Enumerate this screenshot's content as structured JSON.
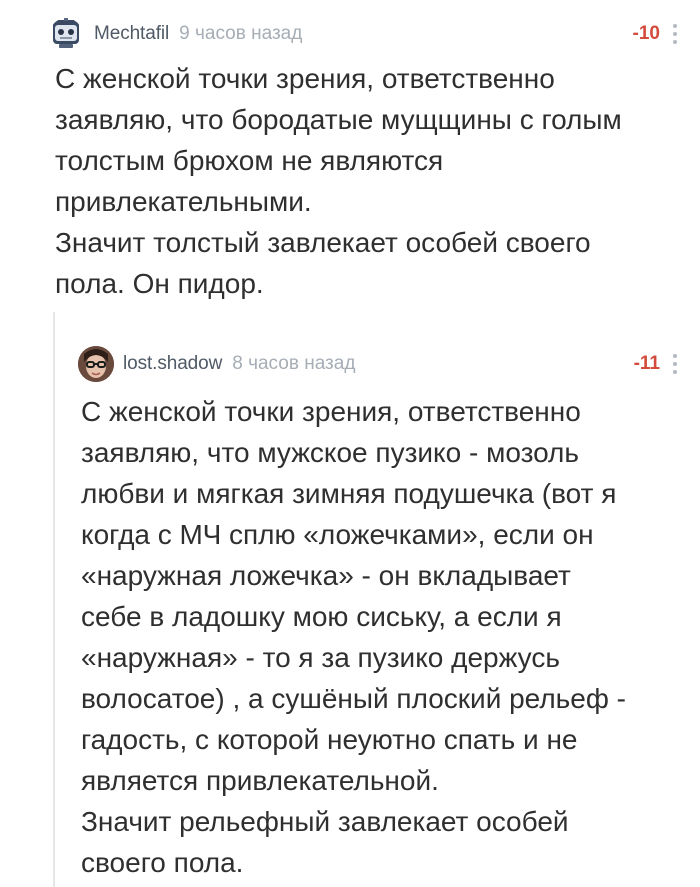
{
  "comments": [
    {
      "author": "Mechtafil",
      "time": "9 часов назад",
      "rating": "-10",
      "avatar_icon": "robot-avatar-icon",
      "text": "С женской точки зрения, ответственно\nзаявляю, что бородатые мущщины с голым\nтолстым брюхом не являются\nпривлекательными.\nЗначит толстый завлекает особей своего\nпола. Он пидор."
    },
    {
      "author": "lost.shadow",
      "time": "8 часов назад",
      "rating": "-11",
      "avatar_icon": "user-photo-avatar",
      "text": "С женской точки зрения, ответственно\nзаявляю, что мужское пузико - мозоль\nлюбви и мягкая зимняя подушечка (вот я\nкогда с МЧ сплю «ложечками», если он\n«наружная ложечка» - он вкладывает\nсебе в ладошку мою сиську, а если я\n«наружная» - то я за пузико держусь\nволосатое) , а сушёный плоский рельеф -\nгадость, с которой неуютно спать и не\nявляется привлекательной.\nЗначит рельефный завлекает особей\nсвоего пола."
    }
  ],
  "colors": {
    "author": "#4f5a66",
    "time": "#a6adb5",
    "rating_negative": "#d24b3d",
    "text": "#2f2f2f",
    "thread_line": "#e6e6e6"
  }
}
